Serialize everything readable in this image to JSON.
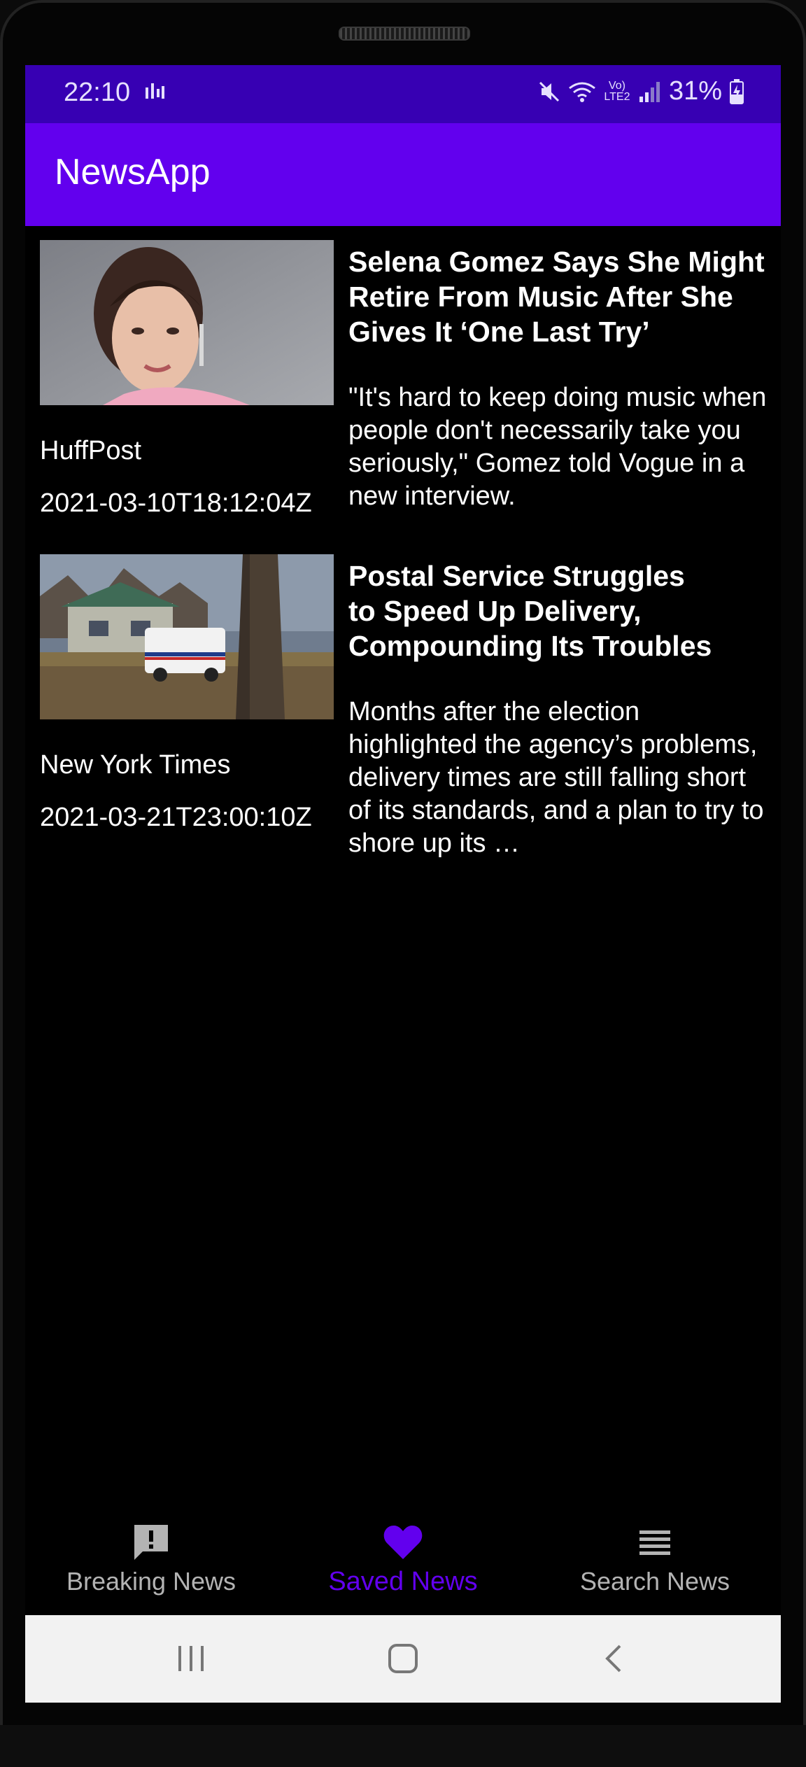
{
  "status_bar": {
    "time": "22:10",
    "network_label": "Vo) LTE2",
    "battery": "31%"
  },
  "app_bar": {
    "title": "NewsApp"
  },
  "articles": [
    {
      "source": "HuffPost",
      "published_at": "2021-03-10T18:12:04Z",
      "title": "Selena Gomez Says She Might Retire From Music After She Gives It ‘One Last Try’",
      "description": "\"It's hard to keep doing music when people don't necessarily take you seriously,\" Gomez told Vogue in a new interview."
    },
    {
      "source": "New York Times",
      "published_at": "2021-03-21T23:00:10Z",
      "title": "Postal Service Struggles to Speed Up Delivery, Compounding Its Troubles",
      "description": "Months after the election highlighted the agency’s problems, delivery times are still falling short of its standards, and a plan to try to shore up its …"
    }
  ],
  "bottom_nav": {
    "items": [
      {
        "label": "Breaking News",
        "icon": "alert-message-icon",
        "active": false
      },
      {
        "label": "Saved News",
        "icon": "heart-icon",
        "active": true
      },
      {
        "label": "Search News",
        "icon": "list-icon",
        "active": false
      }
    ]
  },
  "colors": {
    "primary": "#6200ee",
    "primary_dark": "#3700b3",
    "inactive_nav": "#b3b3b3"
  }
}
